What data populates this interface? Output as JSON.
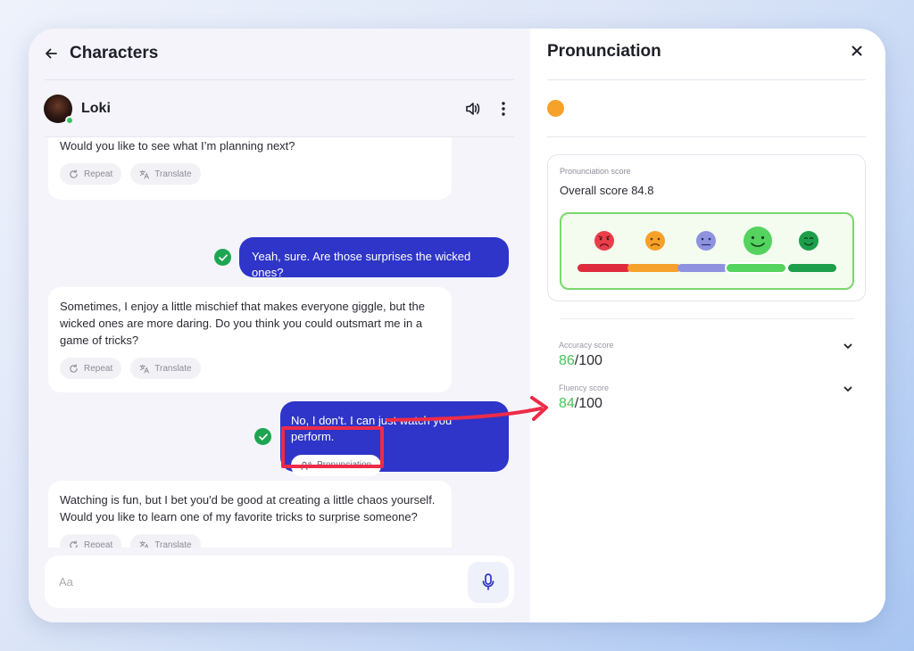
{
  "left": {
    "title": "Characters",
    "character": {
      "name": "Loki"
    },
    "messages": [
      {
        "role": "bot",
        "text": "Would you like to see what I’m planning next?",
        "actions": [
          "Repeat",
          "Translate"
        ]
      },
      {
        "role": "user",
        "text": "Yeah, sure. Are those surprises the wicked ones?"
      },
      {
        "role": "bot",
        "text": "Sometimes, I enjoy a little mischief that makes everyone giggle, but the wicked ones are more daring. Do you think you could outsmart me in a game of tricks?",
        "actions": [
          "Repeat",
          "Translate"
        ]
      },
      {
        "role": "user",
        "text": "No, I don't. I can just watch you perform.",
        "chip": "Pronunciation"
      },
      {
        "role": "bot",
        "text": "Watching is fun, but I bet you'd be good at creating a little chaos yourself. Would you like to learn one of my favorite tricks to surprise someone?",
        "actions": [
          "Repeat",
          "Translate"
        ]
      }
    ],
    "composer": {
      "placeholder": "Aa"
    }
  },
  "right": {
    "title": "Pronunciation",
    "score_label": "Pronunciation score",
    "overall_text": "Overall score 84.8",
    "metrics": [
      {
        "label": "Accuracy score",
        "score": "86",
        "max": "/100"
      },
      {
        "label": "Fluency score",
        "score": "84",
        "max": "/100"
      }
    ]
  },
  "colors": {
    "accent": "#2e35c8",
    "check": "#1fa552",
    "score_green": "#47c35a",
    "highlight": "#ee2b48",
    "orange": "#f6a12a"
  },
  "icons": [
    "back-arrow-icon",
    "speaker-icon",
    "more-vertical-icon",
    "repeat-icon",
    "translate-icon",
    "check-icon",
    "pronunciation-icon",
    "microphone-icon",
    "close-icon",
    "chevron-down-icon"
  ]
}
